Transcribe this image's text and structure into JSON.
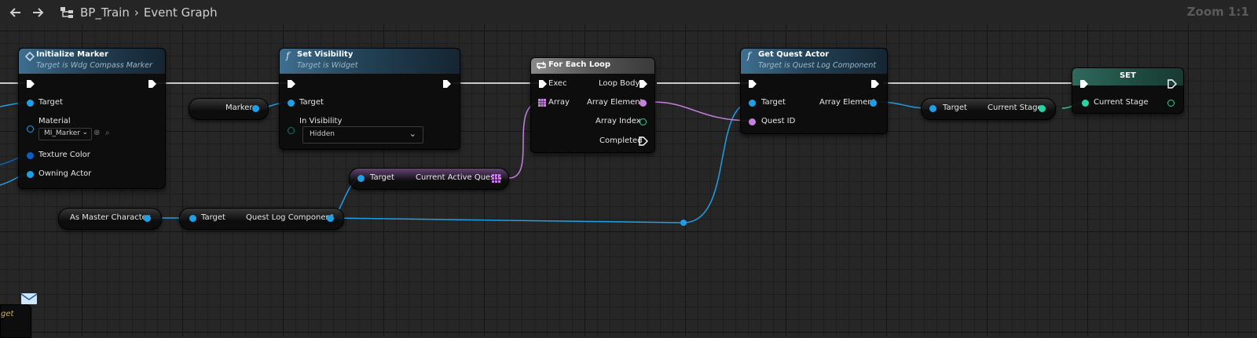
{
  "header": {
    "blueprint": "BP_Train",
    "graph": "Event Graph",
    "zoom": "Zoom 1:1"
  },
  "nodes": {
    "initialize_marker": {
      "title": "Initialize Marker",
      "subtitle": "Target is Wdg Compass Marker",
      "pins": {
        "target": "Target",
        "material": "Material",
        "material_value": "MI_Marker",
        "texture_color": "Texture Color",
        "owning_actor": "Owning Actor"
      }
    },
    "marker_var": {
      "label": "Marker"
    },
    "set_visibility": {
      "title": "Set Visibility",
      "subtitle": "Target is Widget",
      "pins": {
        "target": "Target",
        "in_visibility": "In Visibility",
        "visibility_value": "Hidden"
      }
    },
    "current_active_quests": {
      "target": "Target",
      "output": "Current Active Quests"
    },
    "as_master_character": {
      "label": "As Master Character"
    },
    "quest_log_component": {
      "target": "Target",
      "output": "Quest Log Component"
    },
    "for_each_loop": {
      "title": "For Each Loop",
      "pins": {
        "exec": "Exec",
        "array": "Array",
        "loop_body": "Loop Body",
        "array_element": "Array Element",
        "array_index": "Array Index",
        "completed": "Completed"
      }
    },
    "get_quest_actor": {
      "title": "Get Quest Actor",
      "subtitle": "Target is Quest Log Component",
      "pins": {
        "target": "Target",
        "quest_id": "Quest ID",
        "array_element": "Array Element"
      }
    },
    "current_stage_get": {
      "target": "Target",
      "output": "Current Stage"
    },
    "set_node": {
      "title": "SET",
      "pins": {
        "current_stage": "Current Stage"
      }
    },
    "partial_node": {
      "text": "get"
    }
  },
  "colors": {
    "exec": "#ffffff",
    "object": "#1fa0e6",
    "name": "#c680e0",
    "integer": "#27d2a3",
    "enum": "#0f7a6a",
    "struct": "#0b5fbf"
  }
}
